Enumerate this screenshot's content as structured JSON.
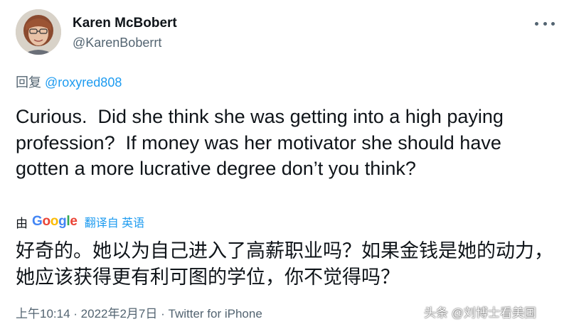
{
  "author": {
    "display_name": "Karen McBobert",
    "handle": "@KarenBoberrt",
    "avatar_icon": "profile-photo"
  },
  "reply": {
    "prefix": "回复",
    "to_handle": "@roxyred808"
  },
  "tweet": {
    "text": "Curious.  Did she think she was getting into a high paying profession?  If money was her motivator she should have gotten a more lucrative degree don’t you think?"
  },
  "translation": {
    "by_label": "由",
    "provider": "Google",
    "link_label": "翻译自 英语",
    "text": "好奇的。她以为自己进入了高薪职业吗？如果金钱是她的动力，她应该获得更有利可图的学位，你不觉得吗？"
  },
  "meta": {
    "time": "上午10:14",
    "separator": " · ",
    "date": "2022年2月7日",
    "source": "Twitter for iPhone"
  },
  "watermark": {
    "text": "头条 @刘博士看美国"
  },
  "colors": {
    "text": "#0f1419",
    "muted": "#536471",
    "link": "#1d9bf0"
  }
}
